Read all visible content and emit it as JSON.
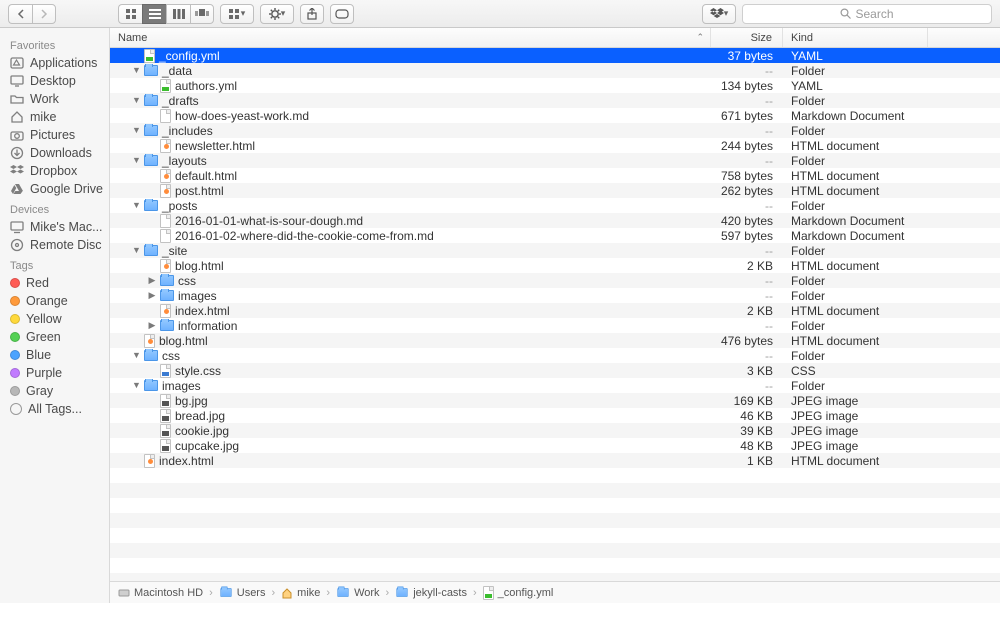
{
  "toolbar": {
    "search_placeholder": "Search"
  },
  "sidebar": {
    "favorites_label": "Favorites",
    "favorites": [
      {
        "icon": "app",
        "label": "Applications"
      },
      {
        "icon": "desktop",
        "label": "Desktop"
      },
      {
        "icon": "folder",
        "label": "Work"
      },
      {
        "icon": "home",
        "label": "mike"
      },
      {
        "icon": "camera",
        "label": "Pictures"
      },
      {
        "icon": "download",
        "label": "Downloads"
      },
      {
        "icon": "dropbox",
        "label": "Dropbox"
      },
      {
        "icon": "gdrive",
        "label": "Google Drive"
      }
    ],
    "devices_label": "Devices",
    "devices": [
      {
        "icon": "mac",
        "label": "Mike's Mac..."
      },
      {
        "icon": "disc",
        "label": "Remote Disc"
      }
    ],
    "tags_label": "Tags",
    "tags": [
      {
        "color": "#ff5b55",
        "label": "Red"
      },
      {
        "color": "#ff9a3b",
        "label": "Orange"
      },
      {
        "color": "#ffd93b",
        "label": "Yellow"
      },
      {
        "color": "#54d154",
        "label": "Green"
      },
      {
        "color": "#4aa3ff",
        "label": "Blue"
      },
      {
        "color": "#c17bff",
        "label": "Purple"
      },
      {
        "color": "#b7b7b7",
        "label": "Gray"
      }
    ],
    "all_tags_label": "All Tags..."
  },
  "columns": {
    "name": "Name",
    "size": "Size",
    "kind": "Kind"
  },
  "rows": [
    {
      "depth": 1,
      "disc": "",
      "icon": "yml",
      "name": "_config.yml",
      "size": "37 bytes",
      "kind": "YAML",
      "sel": true
    },
    {
      "depth": 1,
      "disc": "down",
      "icon": "folder",
      "name": "_data",
      "size": "--",
      "kind": "Folder"
    },
    {
      "depth": 2,
      "disc": "",
      "icon": "yml",
      "name": "authors.yml",
      "size": "134 bytes",
      "kind": "YAML"
    },
    {
      "depth": 1,
      "disc": "down",
      "icon": "folder",
      "name": "_drafts",
      "size": "--",
      "kind": "Folder"
    },
    {
      "depth": 2,
      "disc": "",
      "icon": "page",
      "name": "how-does-yeast-work.md",
      "size": "671 bytes",
      "kind": "Markdown Document"
    },
    {
      "depth": 1,
      "disc": "down",
      "icon": "folder",
      "name": "_includes",
      "size": "--",
      "kind": "Folder"
    },
    {
      "depth": 2,
      "disc": "",
      "icon": "html",
      "name": "newsletter.html",
      "size": "244 bytes",
      "kind": "HTML document"
    },
    {
      "depth": 1,
      "disc": "down",
      "icon": "folder",
      "name": "_layouts",
      "size": "--",
      "kind": "Folder"
    },
    {
      "depth": 2,
      "disc": "",
      "icon": "html",
      "name": "default.html",
      "size": "758 bytes",
      "kind": "HTML document"
    },
    {
      "depth": 2,
      "disc": "",
      "icon": "html",
      "name": "post.html",
      "size": "262 bytes",
      "kind": "HTML document"
    },
    {
      "depth": 1,
      "disc": "down",
      "icon": "folder",
      "name": "_posts",
      "size": "--",
      "kind": "Folder"
    },
    {
      "depth": 2,
      "disc": "",
      "icon": "page",
      "name": "2016-01-01-what-is-sour-dough.md",
      "size": "420 bytes",
      "kind": "Markdown Document"
    },
    {
      "depth": 2,
      "disc": "",
      "icon": "page",
      "name": "2016-01-02-where-did-the-cookie-come-from.md",
      "size": "597 bytes",
      "kind": "Markdown Document"
    },
    {
      "depth": 1,
      "disc": "down",
      "icon": "folder",
      "name": "_site",
      "size": "--",
      "kind": "Folder"
    },
    {
      "depth": 2,
      "disc": "",
      "icon": "html",
      "name": "blog.html",
      "size": "2 KB",
      "kind": "HTML document"
    },
    {
      "depth": 2,
      "disc": "right",
      "icon": "folder",
      "name": "css",
      "size": "--",
      "kind": "Folder"
    },
    {
      "depth": 2,
      "disc": "right",
      "icon": "folder",
      "name": "images",
      "size": "--",
      "kind": "Folder"
    },
    {
      "depth": 2,
      "disc": "",
      "icon": "html",
      "name": "index.html",
      "size": "2 KB",
      "kind": "HTML document"
    },
    {
      "depth": 2,
      "disc": "right",
      "icon": "folder",
      "name": "information",
      "size": "--",
      "kind": "Folder"
    },
    {
      "depth": 1,
      "disc": "",
      "icon": "html",
      "name": "blog.html",
      "size": "476 bytes",
      "kind": "HTML document"
    },
    {
      "depth": 1,
      "disc": "down",
      "icon": "folder",
      "name": "css",
      "size": "--",
      "kind": "Folder"
    },
    {
      "depth": 2,
      "disc": "",
      "icon": "css",
      "name": "style.css",
      "size": "3 KB",
      "kind": "CSS"
    },
    {
      "depth": 1,
      "disc": "down",
      "icon": "folder",
      "name": "images",
      "size": "--",
      "kind": "Folder"
    },
    {
      "depth": 2,
      "disc": "",
      "icon": "img",
      "name": "bg.jpg",
      "size": "169 KB",
      "kind": "JPEG image"
    },
    {
      "depth": 2,
      "disc": "",
      "icon": "img",
      "name": "bread.jpg",
      "size": "46 KB",
      "kind": "JPEG image"
    },
    {
      "depth": 2,
      "disc": "",
      "icon": "img",
      "name": "cookie.jpg",
      "size": "39 KB",
      "kind": "JPEG image"
    },
    {
      "depth": 2,
      "disc": "",
      "icon": "img",
      "name": "cupcake.jpg",
      "size": "48 KB",
      "kind": "JPEG image"
    },
    {
      "depth": 1,
      "disc": "",
      "icon": "html",
      "name": "index.html",
      "size": "1 KB",
      "kind": "HTML document"
    }
  ],
  "breadcrumbs": [
    {
      "icon": "hd",
      "label": "Macintosh HD"
    },
    {
      "icon": "folder",
      "label": "Users"
    },
    {
      "icon": "home",
      "label": "mike"
    },
    {
      "icon": "folder",
      "label": "Work"
    },
    {
      "icon": "folder",
      "label": "jekyll-casts"
    },
    {
      "icon": "yml",
      "label": "_config.yml"
    }
  ]
}
